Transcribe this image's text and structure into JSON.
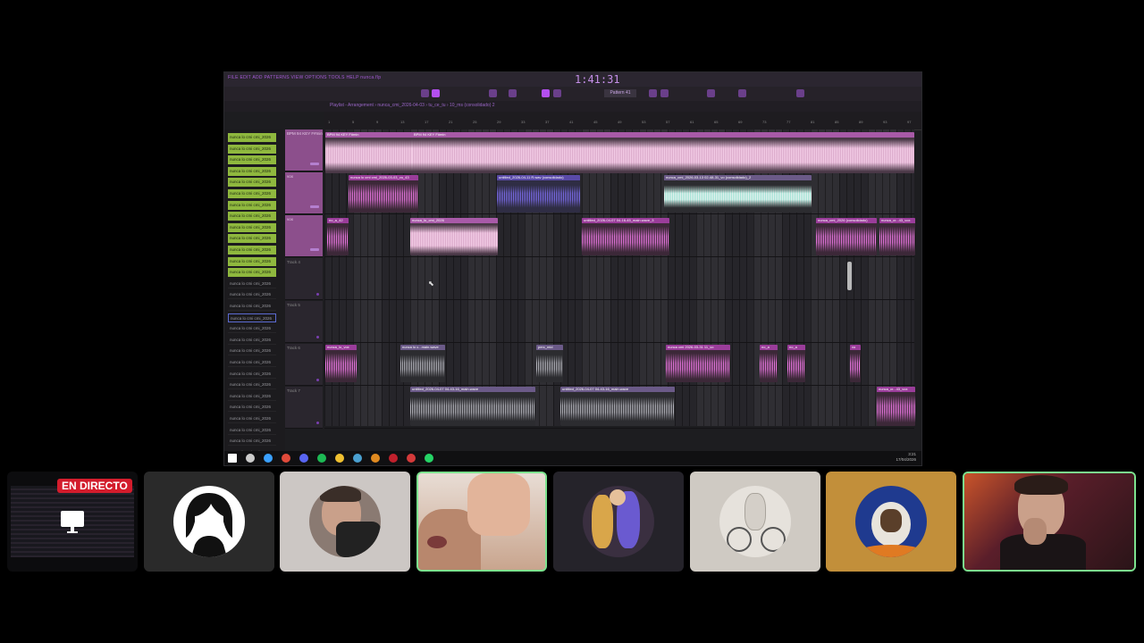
{
  "stream": {
    "live_badge": "EN DIRECTO"
  },
  "fl_studio": {
    "menubar_path": "FILE EDIT ADD PATTERNS VIEW OPTIONS TOOLS HELP   nunca.flp",
    "clock": "1:41:31",
    "pattern_label": "Pattern 41",
    "playlist_path": "Playlist - Arrangement  ›  nunca_cmi_2026-04-03  ›  tu_ce_tu  ›  10_ms (consolidado) 2",
    "ruler_ticks": [
      "1",
      "5",
      "9",
      "13",
      "17",
      "21",
      "25",
      "29",
      "33",
      "37",
      "41",
      "45",
      "49",
      "53",
      "57",
      "61",
      "65",
      "69",
      "73",
      "77",
      "81",
      "85",
      "89",
      "93",
      "97"
    ],
    "browser_items": [
      {
        "label": "nunca lo cmi cmi_2026",
        "style": "green"
      },
      {
        "label": "nunca lo cmi cmi_2026",
        "style": "green"
      },
      {
        "label": "nunca lo cmi cmi_2026",
        "style": "green"
      },
      {
        "label": "nunca lo cmi cmi_2026",
        "style": "green"
      },
      {
        "label": "nunca lo cmi cmi_2026",
        "style": "green"
      },
      {
        "label": "nunca lo cmi cmi_2026",
        "style": "green"
      },
      {
        "label": "nunca lo cmi cmi_2026",
        "style": "green"
      },
      {
        "label": "nunca lo cmi cmi_2026",
        "style": "green"
      },
      {
        "label": "nunca lo cmi cmi_2026",
        "style": "green"
      },
      {
        "label": "nunca lo cmi cmi_2026",
        "style": "green"
      },
      {
        "label": "nunca lo cmi cmi_2026",
        "style": "green"
      },
      {
        "label": "nunca lo cmi cmi_2026",
        "style": "green"
      },
      {
        "label": "nunca lo cmi cmi_2026",
        "style": "green"
      },
      {
        "label": "nunca lo cmi cmi_2026",
        "style": "grey"
      },
      {
        "label": "nunca lo cmi cmi_2026",
        "style": "grey"
      },
      {
        "label": "nunca lo cmi cmi_2026",
        "style": "grey"
      },
      {
        "label": "nunca lo cmi cmi_2026",
        "style": "sel"
      },
      {
        "label": "nunca lo cmi cmi_2026",
        "style": "grey"
      },
      {
        "label": "nunca lo cmi cmi_2026",
        "style": "grey"
      },
      {
        "label": "nunca lo cmi cmi_2026",
        "style": "grey"
      },
      {
        "label": "nunca lo cmi cmi_2026",
        "style": "grey"
      },
      {
        "label": "nunca lo cmi cmi_2026",
        "style": "grey"
      },
      {
        "label": "nunca lo cmi cmi_2026",
        "style": "grey"
      },
      {
        "label": "nunca lo cmi cmi_2026",
        "style": "grey"
      },
      {
        "label": "nunca lo cmi cmi_2026",
        "style": "grey"
      },
      {
        "label": "nunca lo cmi cmi_2026",
        "style": "grey"
      },
      {
        "label": "nunca lo cmi cmi_2026",
        "style": "grey"
      },
      {
        "label": "nunca lo cmi cmi_2026",
        "style": "grey"
      },
      {
        "label": "nunca lo cmi cmi_2026",
        "style": "grey"
      },
      {
        "label": "acapella 2",
        "style": "hl"
      },
      {
        "label": "nunca lo cmi cmi_2",
        "style": "grey"
      }
    ],
    "tracks": [
      {
        "name": "BPM 94 KEY F#min",
        "style": "pink"
      },
      {
        "name": "vox",
        "style": "pink"
      },
      {
        "name": "vox",
        "style": "pink"
      },
      {
        "name": "Track 4",
        "style": "plain"
      },
      {
        "name": "Track 5",
        "style": "plain"
      },
      {
        "name": "Track 6",
        "style": "plain"
      },
      {
        "name": "Track 7",
        "style": "plain"
      }
    ],
    "clips": [
      {
        "title": "BPM 94 KEY F#min",
        "kind": "light"
      },
      {
        "title": "BPM 94 KEY F#min",
        "kind": "light"
      },
      {
        "title": "nunca lo cmi cmi_2026-03-03_vo_43",
        "kind": "pink"
      },
      {
        "title": "untitled_2026-04-11 R.wav (consolidado)",
        "kind": "blue"
      },
      {
        "title": "nunca_cmi_2026-03-13 02-48-31_vo (consolidado)_2",
        "kind": "white"
      },
      {
        "title": "no_a_42",
        "kind": "pink"
      },
      {
        "title": "nunca_lo_cmi_2026",
        "kind": "light"
      },
      {
        "title": "untitled_2026-04-07 04-16-45_main.wave_3",
        "kind": "pink"
      },
      {
        "title": "nunca_cmi_2026 (consolidado)",
        "kind": "pink"
      },
      {
        "title": "nunca_cr...43_vox",
        "kind": "pink"
      },
      {
        "title": "nunca_lo_vox",
        "kind": "pink"
      },
      {
        "title": "nunca lo c...main.wave",
        "kind": "grey"
      },
      {
        "title": "perc_mid",
        "kind": "grey"
      },
      {
        "title": "nunca cmi 2026-03-31 11_vo",
        "kind": "pink"
      },
      {
        "title": "no_a",
        "kind": "pink"
      },
      {
        "title": "no_a",
        "kind": "pink"
      },
      {
        "title": "vo",
        "kind": "pink"
      },
      {
        "title": "untitled_2026-04-07 04-43-16_main.wave",
        "kind": "grey"
      },
      {
        "title": "untitled_2026-04-07 04-43-16_main.wave",
        "kind": "grey"
      },
      {
        "title": "nunca_cr...43_vox",
        "kind": "pink"
      }
    ],
    "taskbar_icons": [
      "windows-start-icon",
      "search-icon",
      "vscode-icon",
      "chrome-icon",
      "discord-icon",
      "spotify-icon",
      "explorer-icon",
      "notepad-icon",
      "fl-studio-icon",
      "obs-icon",
      "app-icon",
      "whatsapp-icon"
    ],
    "taskbar_clock": [
      "3:21",
      "17/04/2026"
    ]
  },
  "participants": [
    {
      "name": "screen-share",
      "kind": "screen"
    },
    {
      "name": "default-avatar",
      "kind": "silhouette"
    },
    {
      "name": "avatar-kid",
      "kind": "photo"
    },
    {
      "name": "camera-girl",
      "kind": "camera",
      "active": true
    },
    {
      "name": "avatar-dance",
      "kind": "photo"
    },
    {
      "name": "avatar-bike",
      "kind": "photo"
    },
    {
      "name": "avatar-penguin",
      "kind": "photo"
    },
    {
      "name": "camera-boy",
      "kind": "camera",
      "active": true
    }
  ],
  "colors": {
    "accent": "#b44ff0",
    "live": "#d31c2c",
    "speaking_border": "#7ce28e",
    "browser_green": "#8fb83e"
  }
}
